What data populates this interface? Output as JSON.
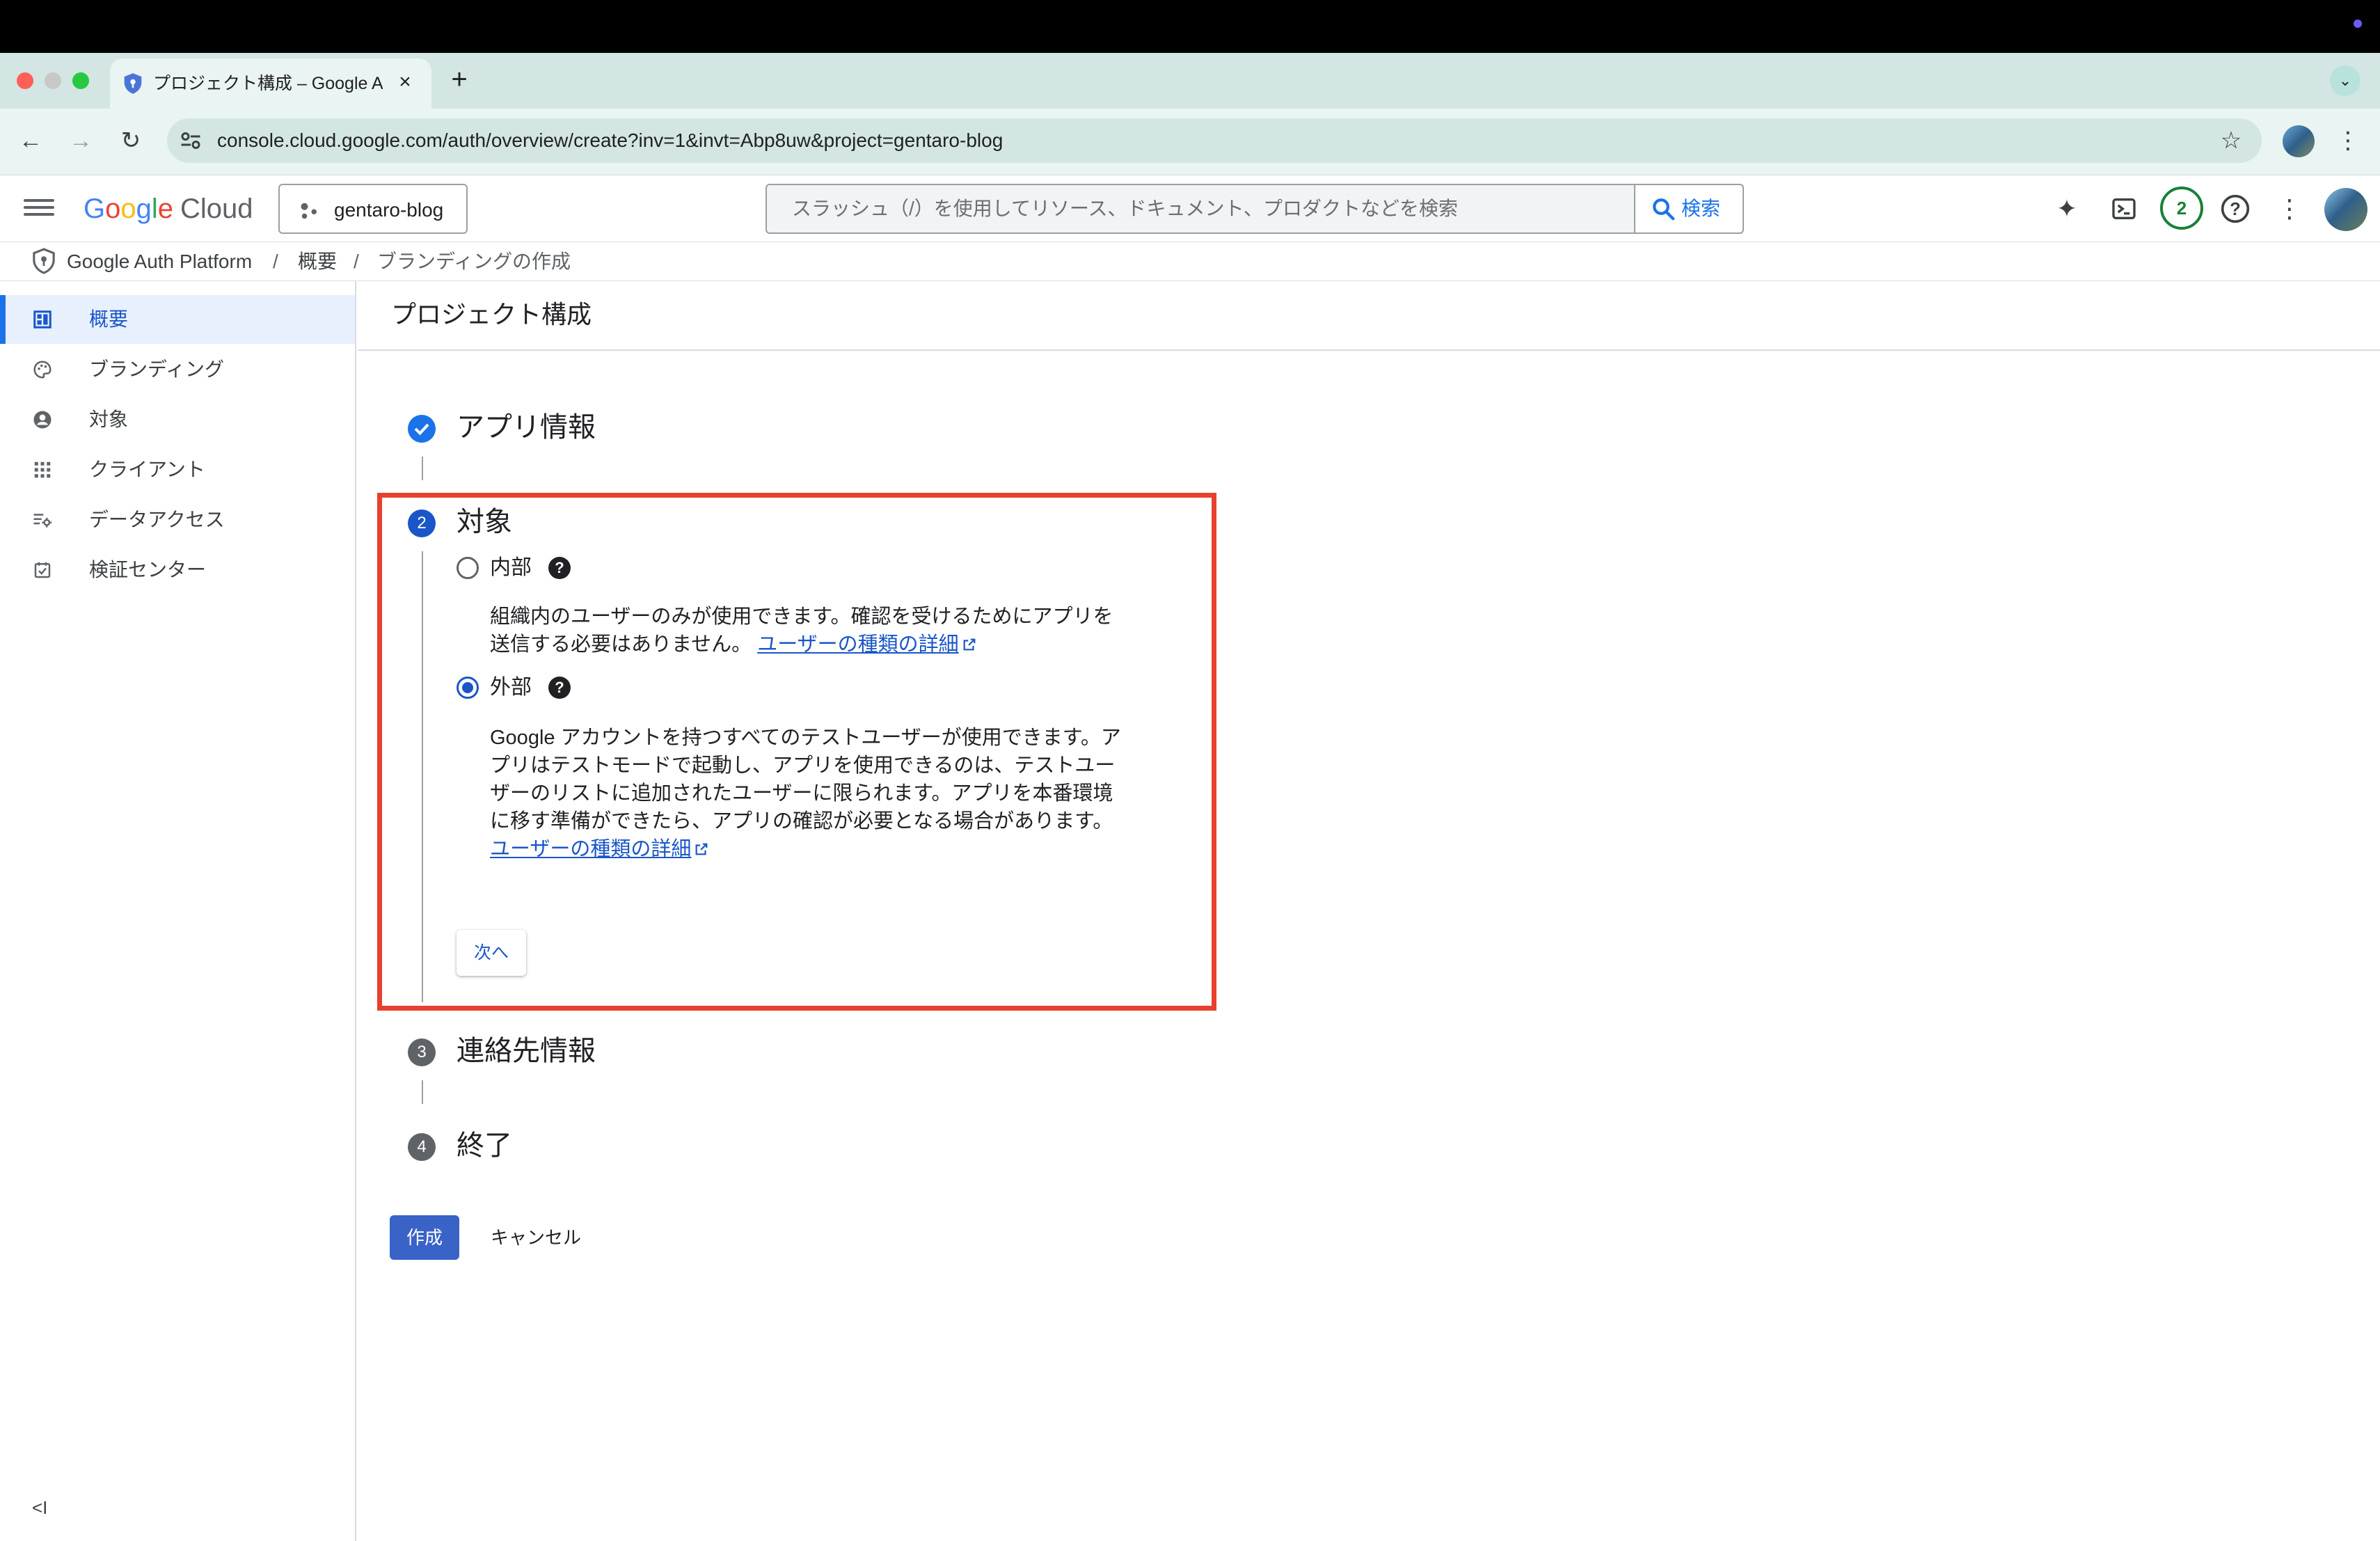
{
  "browser": {
    "tab_title": "プロジェクト構成 – Google Auth Platform",
    "tab_close": "×",
    "new_tab": "+",
    "tab_menu": "⌄",
    "url": "console.cloud.google.com/auth/overview/create?inv=1&invt=Abp8uw&project=gentaro-blog",
    "back": "←",
    "forward": "→",
    "reload": "↻",
    "star": "☆",
    "menu": "⋮",
    "traffic_colors": [
      "#ff5f57",
      "#c8c8c8",
      "#28c840"
    ]
  },
  "header": {
    "logo_google": [
      "G",
      "o",
      "o",
      "g",
      "l",
      "e"
    ],
    "logo_cloud": "Cloud",
    "project_name": "gentaro-blog",
    "search_placeholder": "スラッシュ（/）を使用してリソース、ドキュメント、プロダクトなどを検索",
    "search_button": "検索",
    "gemini_icon": "✦",
    "terminal_icon": ">_",
    "notification_count": "2",
    "help_icon": "?",
    "more_icon": "⋮"
  },
  "breadcrumb": {
    "items": [
      "Google Auth Platform",
      "概要",
      "ブランディングの作成"
    ],
    "separator": "/"
  },
  "sidebar": {
    "items": [
      {
        "label": "概要",
        "icon": "dashboard-icon",
        "active": true
      },
      {
        "label": "ブランディング",
        "icon": "palette-icon",
        "active": false
      },
      {
        "label": "対象",
        "icon": "account-circle-icon",
        "active": false
      },
      {
        "label": "クライアント",
        "icon": "apps-grid-icon",
        "active": false
      },
      {
        "label": "データアクセス",
        "icon": "data-settings-icon",
        "active": false
      },
      {
        "label": "検証センター",
        "icon": "verified-checkbox-icon",
        "active": false
      }
    ],
    "collapse_label": "<I"
  },
  "main": {
    "page_title": "プロジェクト構成",
    "steps": [
      {
        "number": "1",
        "title": "アプリ情報",
        "state": "done"
      },
      {
        "number": "2",
        "title": "対象",
        "state": "active"
      },
      {
        "number": "3",
        "title": "連絡先情報",
        "state": "pending"
      },
      {
        "number": "4",
        "title": "終了",
        "state": "pending"
      }
    ],
    "audience": {
      "options": [
        {
          "label": "内部",
          "checked": false,
          "description": "組織内のユーザーのみが使用できます。確認を受けるためにアプリを送信する必要はありません。",
          "link": "ユーザーの種類の詳細"
        },
        {
          "label": "外部",
          "checked": true,
          "description": "Google アカウントを持つすべてのテストユーザーが使用できます。アプリはテストモードで起動し、アプリを使用できるのは、テストユーザーのリストに追加されたユーザーに限られます。アプリを本番環境に移す準備ができたら、アプリの確認が必要となる場合があります。",
          "link": "ユーザーの種類の詳細"
        }
      ],
      "help_glyph": "?",
      "next_button": "次へ"
    },
    "create_button": "作成",
    "cancel_button": "キャンセル",
    "highlight_color": "#e8402f"
  }
}
